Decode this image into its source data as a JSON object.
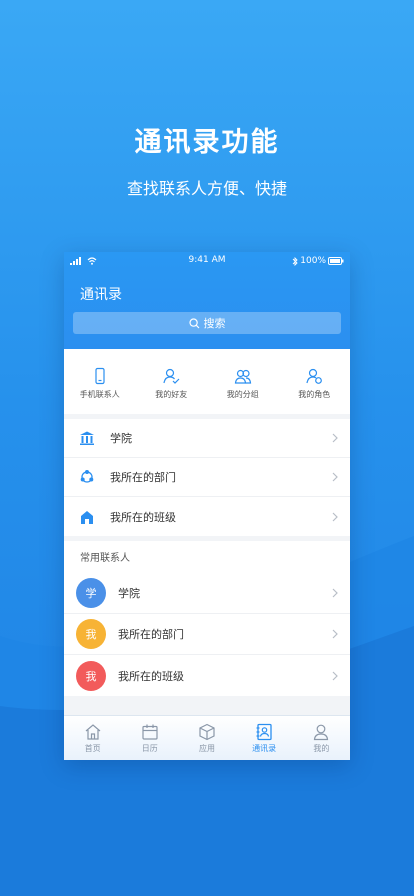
{
  "promo": {
    "title": "通讯录功能",
    "subtitle": "查找联系人方便、快捷"
  },
  "status_bar": {
    "time": "9:41 AM",
    "battery": "100%"
  },
  "header": {
    "title": "通讯录",
    "search_placeholder": "搜索"
  },
  "quick_actions": [
    {
      "label": "手机联系人",
      "icon": "phone-icon"
    },
    {
      "label": "我的好友",
      "icon": "friend-icon"
    },
    {
      "label": "我的分组",
      "icon": "group-icon"
    },
    {
      "label": "我的角色",
      "icon": "role-icon"
    }
  ],
  "menu": [
    {
      "label": "学院",
      "icon": "college-icon"
    },
    {
      "label": "我所在的部门",
      "icon": "department-icon"
    },
    {
      "label": "我所在的班级",
      "icon": "class-icon"
    }
  ],
  "contacts": {
    "header": "常用联系人",
    "items": [
      {
        "avatar": "学",
        "name": "学院",
        "color": "#4a90e8"
      },
      {
        "avatar": "我",
        "name": "我所在的部门",
        "color": "#f7b335"
      },
      {
        "avatar": "我",
        "name": "我所在的班级",
        "color": "#f25b5b"
      }
    ]
  },
  "tabs": [
    {
      "label": "首页",
      "icon": "home-icon",
      "active": false
    },
    {
      "label": "日历",
      "icon": "calendar-icon",
      "active": false
    },
    {
      "label": "应用",
      "icon": "apps-icon",
      "active": false
    },
    {
      "label": "通讯录",
      "icon": "contacts-icon",
      "active": true
    },
    {
      "label": "我的",
      "icon": "profile-icon",
      "active": false
    }
  ],
  "colors": {
    "accent": "#2b8ff0",
    "background": "#2691ec"
  }
}
